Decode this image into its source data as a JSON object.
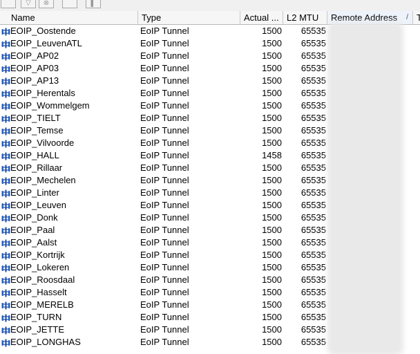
{
  "toolbar": {
    "buttons": [
      {
        "name": "add",
        "glyph": ""
      },
      {
        "name": "filter",
        "glyph": "▽"
      },
      {
        "name": "reset",
        "glyph": "⊗"
      },
      {
        "name": "comment",
        "glyph": ""
      },
      {
        "name": "settings",
        "glyph": "▌"
      }
    ]
  },
  "table": {
    "columns": {
      "name": "Name",
      "type": "Type",
      "actual_mtu": "Actual ...",
      "l2_mtu": "L2 MTU",
      "remote_address": "Remote Address",
      "extra": "T"
    },
    "sort_indicator": "/",
    "rows": [
      {
        "name": "EOIP_Oostende",
        "type": "EoIP Tunnel",
        "actual_mtu": "1500",
        "l2_mtu": "65535"
      },
      {
        "name": "EOIP_LeuvenATL",
        "type": "EoIP Tunnel",
        "actual_mtu": "1500",
        "l2_mtu": "65535"
      },
      {
        "name": "EOIP_AP02",
        "type": "EoIP Tunnel",
        "actual_mtu": "1500",
        "l2_mtu": "65535"
      },
      {
        "name": "EOIP_AP03",
        "type": "EoIP Tunnel",
        "actual_mtu": "1500",
        "l2_mtu": "65535"
      },
      {
        "name": "EOIP_AP13",
        "type": "EoIP Tunnel",
        "actual_mtu": "1500",
        "l2_mtu": "65535"
      },
      {
        "name": "EOIP_Herentals",
        "type": "EoIP Tunnel",
        "actual_mtu": "1500",
        "l2_mtu": "65535"
      },
      {
        "name": "EOIP_Wommelgem",
        "type": "EoIP Tunnel",
        "actual_mtu": "1500",
        "l2_mtu": "65535"
      },
      {
        "name": "EOIP_TIELT",
        "type": "EoIP Tunnel",
        "actual_mtu": "1500",
        "l2_mtu": "65535"
      },
      {
        "name": "EOIP_Temse",
        "type": "EoIP Tunnel",
        "actual_mtu": "1500",
        "l2_mtu": "65535"
      },
      {
        "name": "EOIP_Vilvoorde",
        "type": "EoIP Tunnel",
        "actual_mtu": "1500",
        "l2_mtu": "65535"
      },
      {
        "name": "EOIP_HALL",
        "type": "EoIP Tunnel",
        "actual_mtu": "1458",
        "l2_mtu": "65535"
      },
      {
        "name": "EOIP_Rillaar",
        "type": "EoIP Tunnel",
        "actual_mtu": "1500",
        "l2_mtu": "65535"
      },
      {
        "name": "EOIP_Mechelen",
        "type": "EoIP Tunnel",
        "actual_mtu": "1500",
        "l2_mtu": "65535"
      },
      {
        "name": "EOIP_Linter",
        "type": "EoIP Tunnel",
        "actual_mtu": "1500",
        "l2_mtu": "65535"
      },
      {
        "name": "EOIP_Leuven",
        "type": "EoIP Tunnel",
        "actual_mtu": "1500",
        "l2_mtu": "65535"
      },
      {
        "name": "EOIP_Donk",
        "type": "EoIP Tunnel",
        "actual_mtu": "1500",
        "l2_mtu": "65535"
      },
      {
        "name": "EOIP_Paal",
        "type": "EoIP Tunnel",
        "actual_mtu": "1500",
        "l2_mtu": "65535"
      },
      {
        "name": "EOIP_Aalst",
        "type": "EoIP Tunnel",
        "actual_mtu": "1500",
        "l2_mtu": "65535"
      },
      {
        "name": "EOIP_Kortrijk",
        "type": "EoIP Tunnel",
        "actual_mtu": "1500",
        "l2_mtu": "65535"
      },
      {
        "name": "EOIP_Lokeren",
        "type": "EoIP Tunnel",
        "actual_mtu": "1500",
        "l2_mtu": "65535"
      },
      {
        "name": "EOIP_Roosdaal",
        "type": "EoIP Tunnel",
        "actual_mtu": "1500",
        "l2_mtu": "65535"
      },
      {
        "name": "EOIP_Hasselt",
        "type": "EoIP Tunnel",
        "actual_mtu": "1500",
        "l2_mtu": "65535"
      },
      {
        "name": "EOIP_MERELB",
        "type": "EoIP Tunnel",
        "actual_mtu": "1500",
        "l2_mtu": "65535"
      },
      {
        "name": "EOIP_TURN",
        "type": "EoIP Tunnel",
        "actual_mtu": "1500",
        "l2_mtu": "65535"
      },
      {
        "name": "EOIP_JETTE",
        "type": "EoIP Tunnel",
        "actual_mtu": "1500",
        "l2_mtu": "65535"
      },
      {
        "name": "EOIP_LONGHAS",
        "type": "EoIP Tunnel",
        "actual_mtu": "1500",
        "l2_mtu": "65535"
      }
    ]
  },
  "icons": {
    "row": "tunnel-interface-icon"
  },
  "colors": {
    "icon": "#2b5fb8",
    "header": "#f6f6f6",
    "redaction": "#e9e9e9"
  }
}
